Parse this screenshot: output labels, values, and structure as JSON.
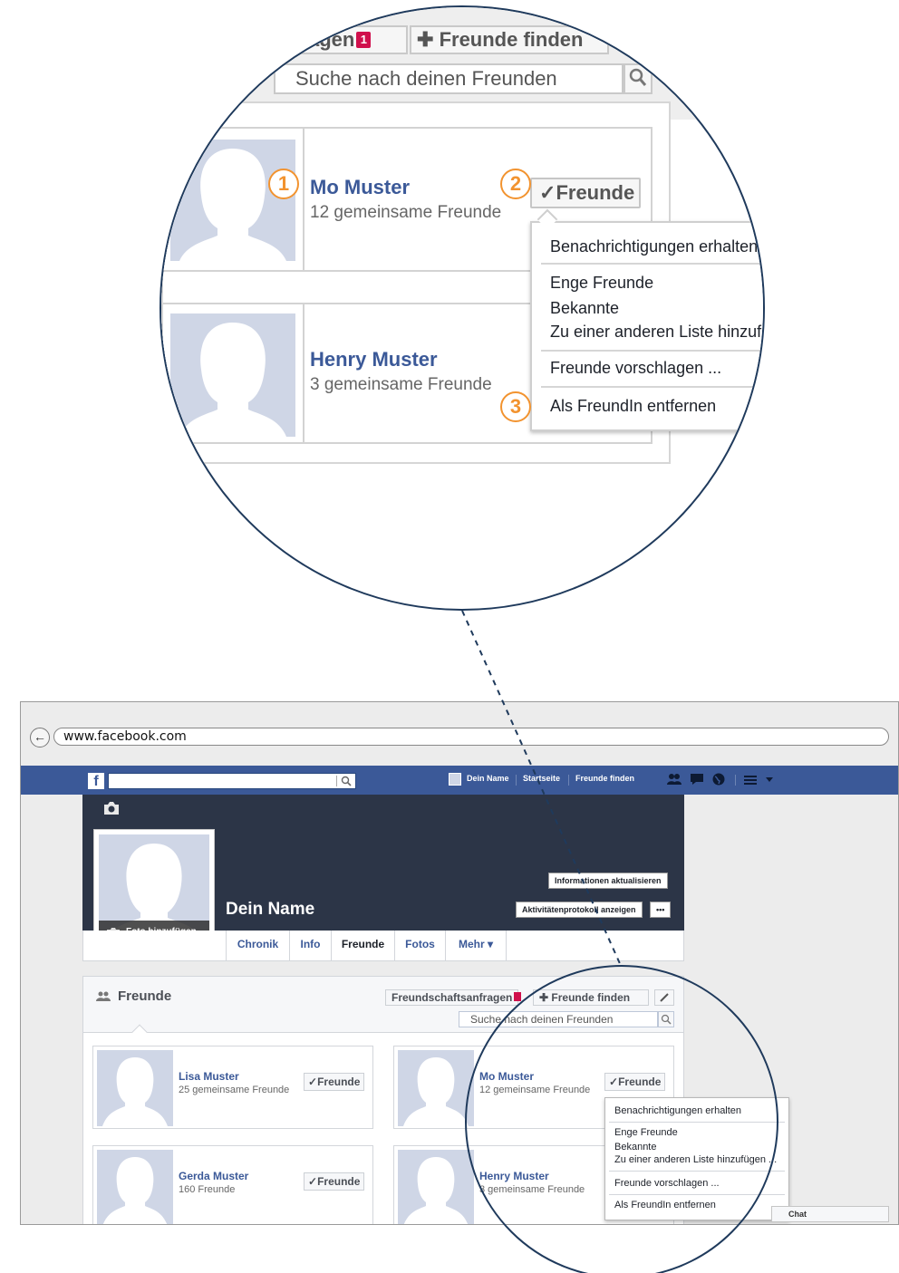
{
  "zoom": {
    "tab_requests_fragment": "agen",
    "tab_requests_badge": "1",
    "tab_find_friends": "Freunde finden",
    "search_placeholder": "Suche nach deinen Freunden",
    "cards": [
      {
        "name": "Mo Muster",
        "mutual": "12 gemeinsame Freunde"
      },
      {
        "name": "Henry Muster",
        "mutual": "3 gemeinsame Freunde"
      }
    ],
    "friends_button": "Freunde",
    "menu": {
      "notifications": "Benachrichtigungen erhalten",
      "close_friends": "Enge Freunde",
      "acquaintances": "Bekannte",
      "add_to_list": "Zu einer anderen Liste hinzufügen ...",
      "suggest": "Freunde vorschlagen ...",
      "remove": "Als FreundIn entfernen"
    },
    "markers": [
      "1",
      "2",
      "3"
    ]
  },
  "browser": {
    "url": "www.facebook.com",
    "topbar": {
      "user_name": "Dein Name",
      "home": "Startseite",
      "find_friends": "Freunde finden"
    },
    "profile": {
      "name": "Dein Name",
      "add_photo": "Foto hinzufügen",
      "update_info": "Informationen aktualisieren",
      "activity_log": "Aktivitätenprotokoll anzeigen",
      "more_dots": "•••"
    },
    "tabs": [
      "Chronik",
      "Info",
      "Freunde",
      "Fotos",
      "Mehr ▾"
    ],
    "friends_panel": {
      "title": "Freunde",
      "requests": "Freundschaftsanfragen",
      "find_friends": "Freunde finden",
      "search_placeholder": "Suche nach deinen Freunden"
    },
    "friend_cards": [
      {
        "name": "Lisa Muster",
        "sub": "25 gemeinsame Freunde",
        "button": "Freunde"
      },
      {
        "name": "Mo Muster",
        "sub": "12 gemeinsame Freunde",
        "button": "Freunde"
      },
      {
        "name": "Gerda Muster",
        "sub": "160 Freunde",
        "button": "Freunde"
      },
      {
        "name": "Henry Muster",
        "sub": "3 gemeinsame Freunde",
        "button": "Freunde"
      }
    ],
    "menu": {
      "notifications": "Benachrichtigungen erhalten",
      "close_friends": "Enge Freunde",
      "acquaintances": "Bekannte",
      "add_to_list": "Zu einer anderen Liste hinzufügen ...",
      "suggest": "Freunde vorschlagen ...",
      "remove": "Als FreundIn entfernen"
    },
    "chat": "Chat"
  },
  "colors": {
    "facebook_blue": "#3b5998",
    "marker_orange": "#f2932f",
    "outline_navy": "#1f3a5c",
    "badge_red": "#d0104c"
  }
}
